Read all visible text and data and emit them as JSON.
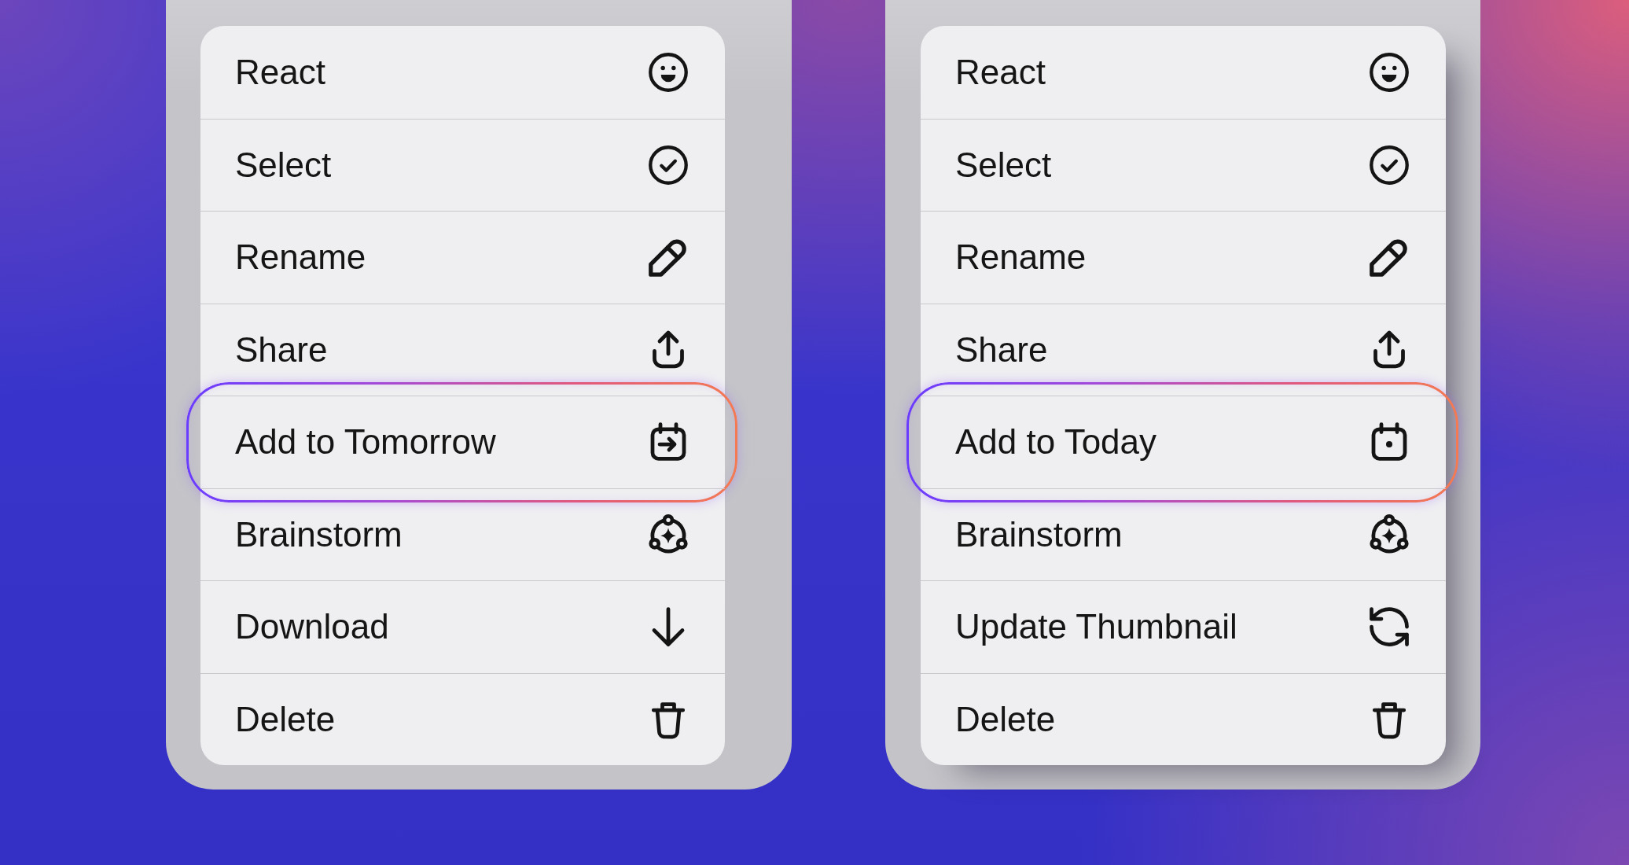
{
  "menus": [
    {
      "items": [
        {
          "label": "React",
          "kind": "react",
          "highlighted": false
        },
        {
          "label": "Select",
          "kind": "select",
          "highlighted": false
        },
        {
          "label": "Rename",
          "kind": "rename",
          "highlighted": false
        },
        {
          "label": "Share",
          "kind": "share",
          "highlighted": false
        },
        {
          "label": "Add to Tomorrow",
          "kind": "tomorrow",
          "highlighted": true
        },
        {
          "label": "Brainstorm",
          "kind": "brainstorm",
          "highlighted": false
        },
        {
          "label": "Download",
          "kind": "download",
          "highlighted": false
        },
        {
          "label": "Delete",
          "kind": "delete",
          "highlighted": false
        }
      ]
    },
    {
      "items": [
        {
          "label": "React",
          "kind": "react",
          "highlighted": false
        },
        {
          "label": "Select",
          "kind": "select",
          "highlighted": false
        },
        {
          "label": "Rename",
          "kind": "rename",
          "highlighted": false
        },
        {
          "label": "Share",
          "kind": "share",
          "highlighted": false
        },
        {
          "label": "Add to Today",
          "kind": "today",
          "highlighted": true
        },
        {
          "label": "Brainstorm",
          "kind": "brainstorm",
          "highlighted": false
        },
        {
          "label": "Update Thumbnail",
          "kind": "refresh",
          "highlighted": false
        },
        {
          "label": "Delete",
          "kind": "delete",
          "highlighted": false
        }
      ]
    }
  ]
}
